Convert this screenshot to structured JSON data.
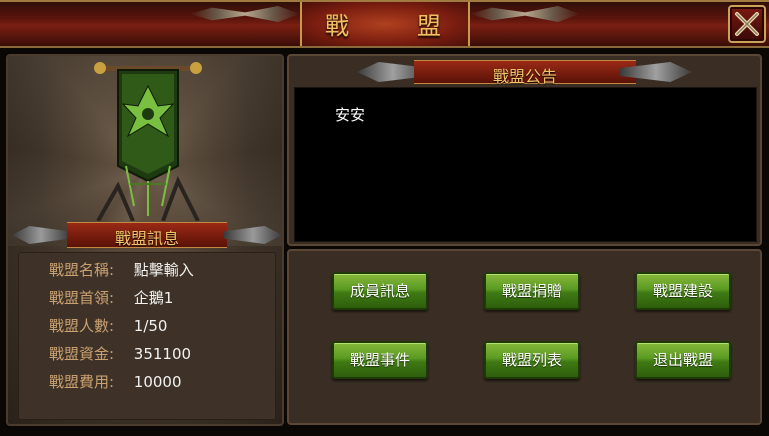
{
  "window": {
    "title": "戰　盟"
  },
  "info_panel": {
    "header": "戰盟訊息",
    "rows": [
      {
        "label": "戰盟名稱:",
        "value": "點擊輸入"
      },
      {
        "label": "戰盟首領:",
        "value": "企鵝1"
      },
      {
        "label": "戰盟人數:",
        "value": "1/50"
      },
      {
        "label": "戰盟資金:",
        "value": "351100"
      },
      {
        "label": "戰盟費用:",
        "value": "10000"
      }
    ]
  },
  "notice_panel": {
    "header": "戰盟公告",
    "content": "安安"
  },
  "actions": {
    "buttons": [
      {
        "label": "成員訊息"
      },
      {
        "label": "戰盟捐贈"
      },
      {
        "label": "戰盟建設"
      },
      {
        "label": "戰盟事件"
      },
      {
        "label": "戰盟列表"
      },
      {
        "label": "退出戰盟"
      }
    ]
  },
  "icons": {
    "close": "close-icon",
    "banner": "guild-banner-emblem"
  },
  "colors": {
    "title_gold": "#f0c060",
    "header_red": "#9a2a15",
    "button_green": "#5a9a22",
    "label_tan": "#c9a070"
  }
}
